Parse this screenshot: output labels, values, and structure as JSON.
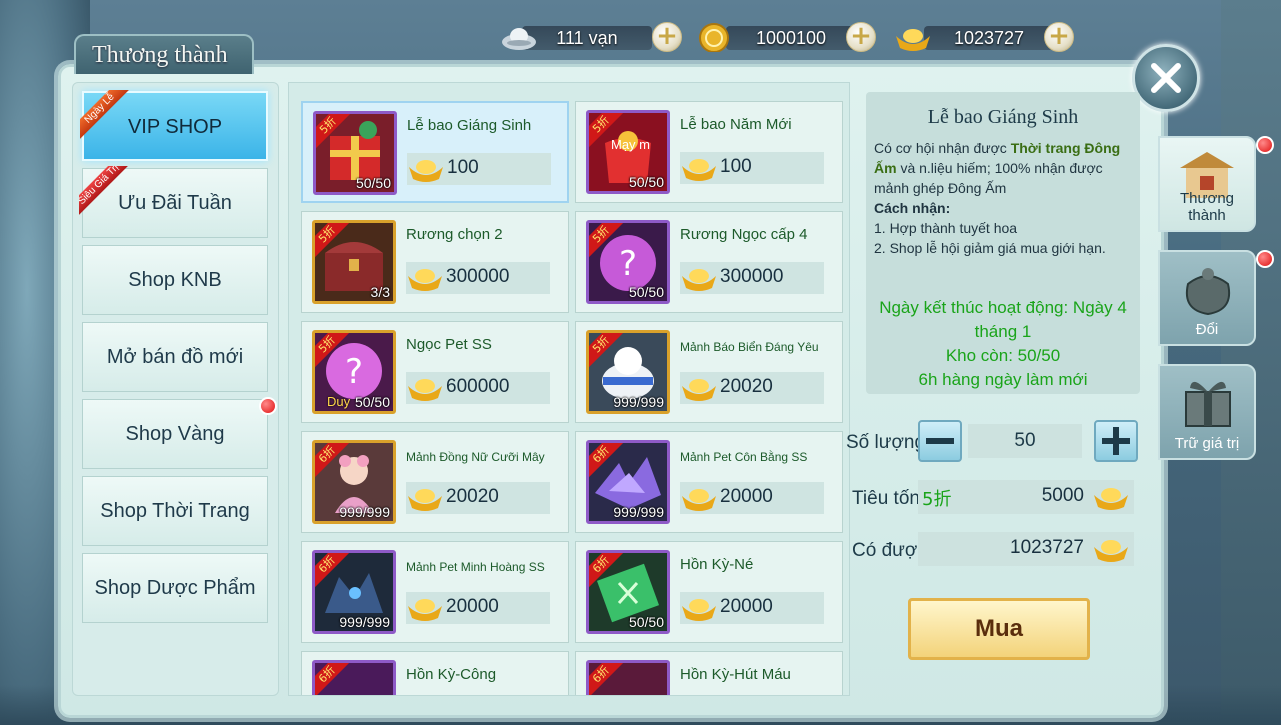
{
  "currencies": [
    {
      "icon": "silver-ingot-icon",
      "value": "111 vạn"
    },
    {
      "icon": "gold-coin-icon",
      "value": "1000100"
    },
    {
      "icon": "gold-ingot-icon",
      "value": "1023727"
    }
  ],
  "window_title": "Thương thành",
  "left_menu": [
    {
      "label": "VIP SHOP",
      "ribbon": "Ngày Lễ",
      "active": true
    },
    {
      "label": "Ưu Đãi Tuần",
      "ribbon": "Siêu Giá Trị"
    },
    {
      "label": "Shop KNB"
    },
    {
      "label": "Mở bán đồ mới"
    },
    {
      "label": "Shop Vàng",
      "notify": true
    },
    {
      "label": "Shop Thời Trang"
    },
    {
      "label": "Shop Dược Phẩm"
    }
  ],
  "items": [
    {
      "name": "Lễ bao Giáng Sinh",
      "price": "100",
      "discount": "5折",
      "stock": "50/50",
      "frame": "purple",
      "selected": true
    },
    {
      "name": "Lễ bao Năm Mới",
      "price": "100",
      "discount": "5折",
      "stock": "50/50",
      "frame": "purple",
      "overlay": "Mạy m"
    },
    {
      "name": "Rương chọn 2",
      "price": "300000",
      "discount": "5折",
      "stock": "3/3",
      "frame": "gold"
    },
    {
      "name": "Rương Ngọc cấp 4",
      "price": "300000",
      "discount": "5折",
      "stock": "50/50",
      "frame": "purple"
    },
    {
      "name": "Ngọc Pet SS",
      "price": "600000",
      "discount": "5折",
      "stock": "50/50",
      "frame": "gold",
      "overlay": "Duy"
    },
    {
      "name": "Mảnh Báo Biển Đáng Yêu",
      "price": "20020",
      "discount": "5折",
      "stock": "999/999",
      "frame": "gold",
      "small": true
    },
    {
      "name": "Mảnh Đồng Nữ Cưỡi Mây",
      "price": "20020",
      "discount": "6折",
      "stock": "999/999",
      "frame": "gold",
      "small": true
    },
    {
      "name": "Mảnh Pet Côn Bằng SS",
      "price": "20000",
      "discount": "6折",
      "stock": "999/999",
      "frame": "purple",
      "small": true
    },
    {
      "name": "Mảnh Pet Minh Hoàng SS",
      "price": "20000",
      "discount": "6折",
      "stock": "999/999",
      "frame": "purple",
      "small": true
    },
    {
      "name": "Hồn Kỳ-Né",
      "price": "20000",
      "discount": "6折",
      "stock": "50/50",
      "frame": "purple"
    },
    {
      "name": "Hồn Kỳ-Công",
      "price": "",
      "discount": "6折",
      "stock": "",
      "frame": "purple"
    },
    {
      "name": "Hồn Kỳ-Hút Máu",
      "price": "",
      "discount": "6折",
      "stock": "",
      "frame": "purple"
    }
  ],
  "detail": {
    "title": "Lễ bao Giáng Sinh",
    "desc_prefix": "Có cơ hội nhận được ",
    "desc_highlight": "Thời trang Đông Ấm",
    "desc_suffix": " và n.liệu hiếm; 100% nhận được mảnh ghép Đông Ấm",
    "how_title": "Cách nhận:",
    "how_1": "1. Hợp thành tuyết hoa",
    "how_2": "2. Shop lễ hội giảm giá mua giới hạn.",
    "end_date": "Ngày kết thúc hoạt động: Ngày 4 tháng 1",
    "remaining": "Kho còn: 50/50",
    "refresh": "6h hàng ngày làm mới"
  },
  "purchase": {
    "qty_label": "Số lượng",
    "qty_value": "50",
    "cost_label": "Tiêu tốn",
    "cost_discount": "5折",
    "cost_value": "5000",
    "have_label": "Có được",
    "have_value": "1023727",
    "buy_label": "Mua"
  },
  "right_tabs": [
    {
      "label": "Thương thành",
      "icon": "shop-pavilion-icon",
      "active": true,
      "notify": true
    },
    {
      "label": "Đổi",
      "icon": "exchange-bag-icon",
      "notify": true
    },
    {
      "label": "Trữ giá trị",
      "icon": "gift-box-icon"
    }
  ]
}
